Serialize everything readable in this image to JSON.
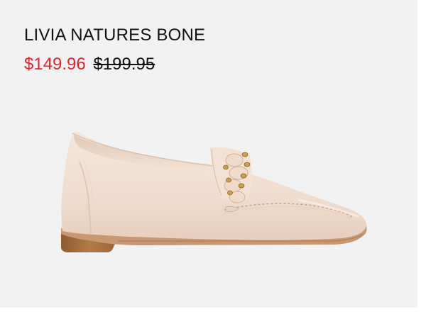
{
  "product": {
    "name": "LIVIA NATURES BONE",
    "sale_price": "$149.96",
    "original_price": "$199.95",
    "image_alt": "Bone leather loafer with braided chain strap",
    "colors": {
      "sale_price": "#e8212b",
      "background": "#f2f2f2",
      "leather": "#f1ddd0",
      "heel": "#a8703f"
    }
  }
}
